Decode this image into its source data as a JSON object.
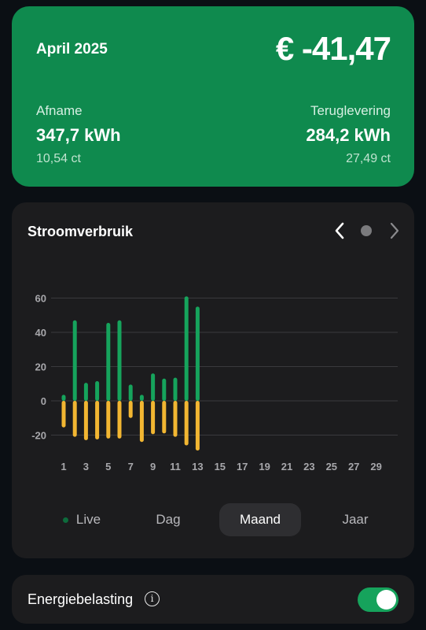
{
  "summary": {
    "month": "April 2025",
    "total": "€ -41,47",
    "afname_label": "Afname",
    "afname_kwh": "347,7 kWh",
    "afname_price": "10,54 ct",
    "teruglevering_label": "Teruglevering",
    "teruglevering_kwh": "284,2 kWh",
    "teruglevering_price": "27,49 ct"
  },
  "chart_card": {
    "title": "Stroomverbruik",
    "prev_icon": "chevron-left-icon",
    "page_dot_icon": "dot-icon",
    "next_icon": "chevron-right-icon"
  },
  "chart_data": {
    "type": "bar",
    "title": "Stroomverbruik",
    "xlabel": "",
    "ylabel": "",
    "ylim": [
      -30,
      60
    ],
    "y_ticks": [
      60,
      40,
      20,
      0,
      -20
    ],
    "x_ticks": [
      1,
      3,
      5,
      7,
      9,
      11,
      13,
      15,
      17,
      19,
      21,
      23,
      25,
      27,
      29
    ],
    "x_range": [
      1,
      30
    ],
    "categories": [
      1,
      2,
      3,
      4,
      5,
      6,
      7,
      8,
      9,
      10,
      11,
      12,
      13
    ],
    "series": [
      {
        "values": [
          3.5,
          47,
          10.5,
          11.5,
          45.5,
          47,
          9.5,
          3.5,
          16,
          13,
          13.5,
          61,
          55
        ],
        "color": "#16a35c"
      },
      {
        "values": [
          -15.5,
          -21,
          -23,
          -22.5,
          -22,
          -22,
          -10,
          -24,
          -19.5,
          -19,
          -21,
          -26,
          -29
        ],
        "color": "#f2b632"
      }
    ],
    "grid": true,
    "legend": "none"
  },
  "tabs": [
    {
      "label": "Live",
      "active": false,
      "dot_color": "#0d6b3c"
    },
    {
      "label": "Dag",
      "active": false
    },
    {
      "label": "Maand",
      "active": true
    },
    {
      "label": "Jaar",
      "active": false
    }
  ],
  "tax": {
    "label": "Energiebelasting",
    "info_icon": "info-icon",
    "info_glyph": "i",
    "toggle_on": true
  }
}
